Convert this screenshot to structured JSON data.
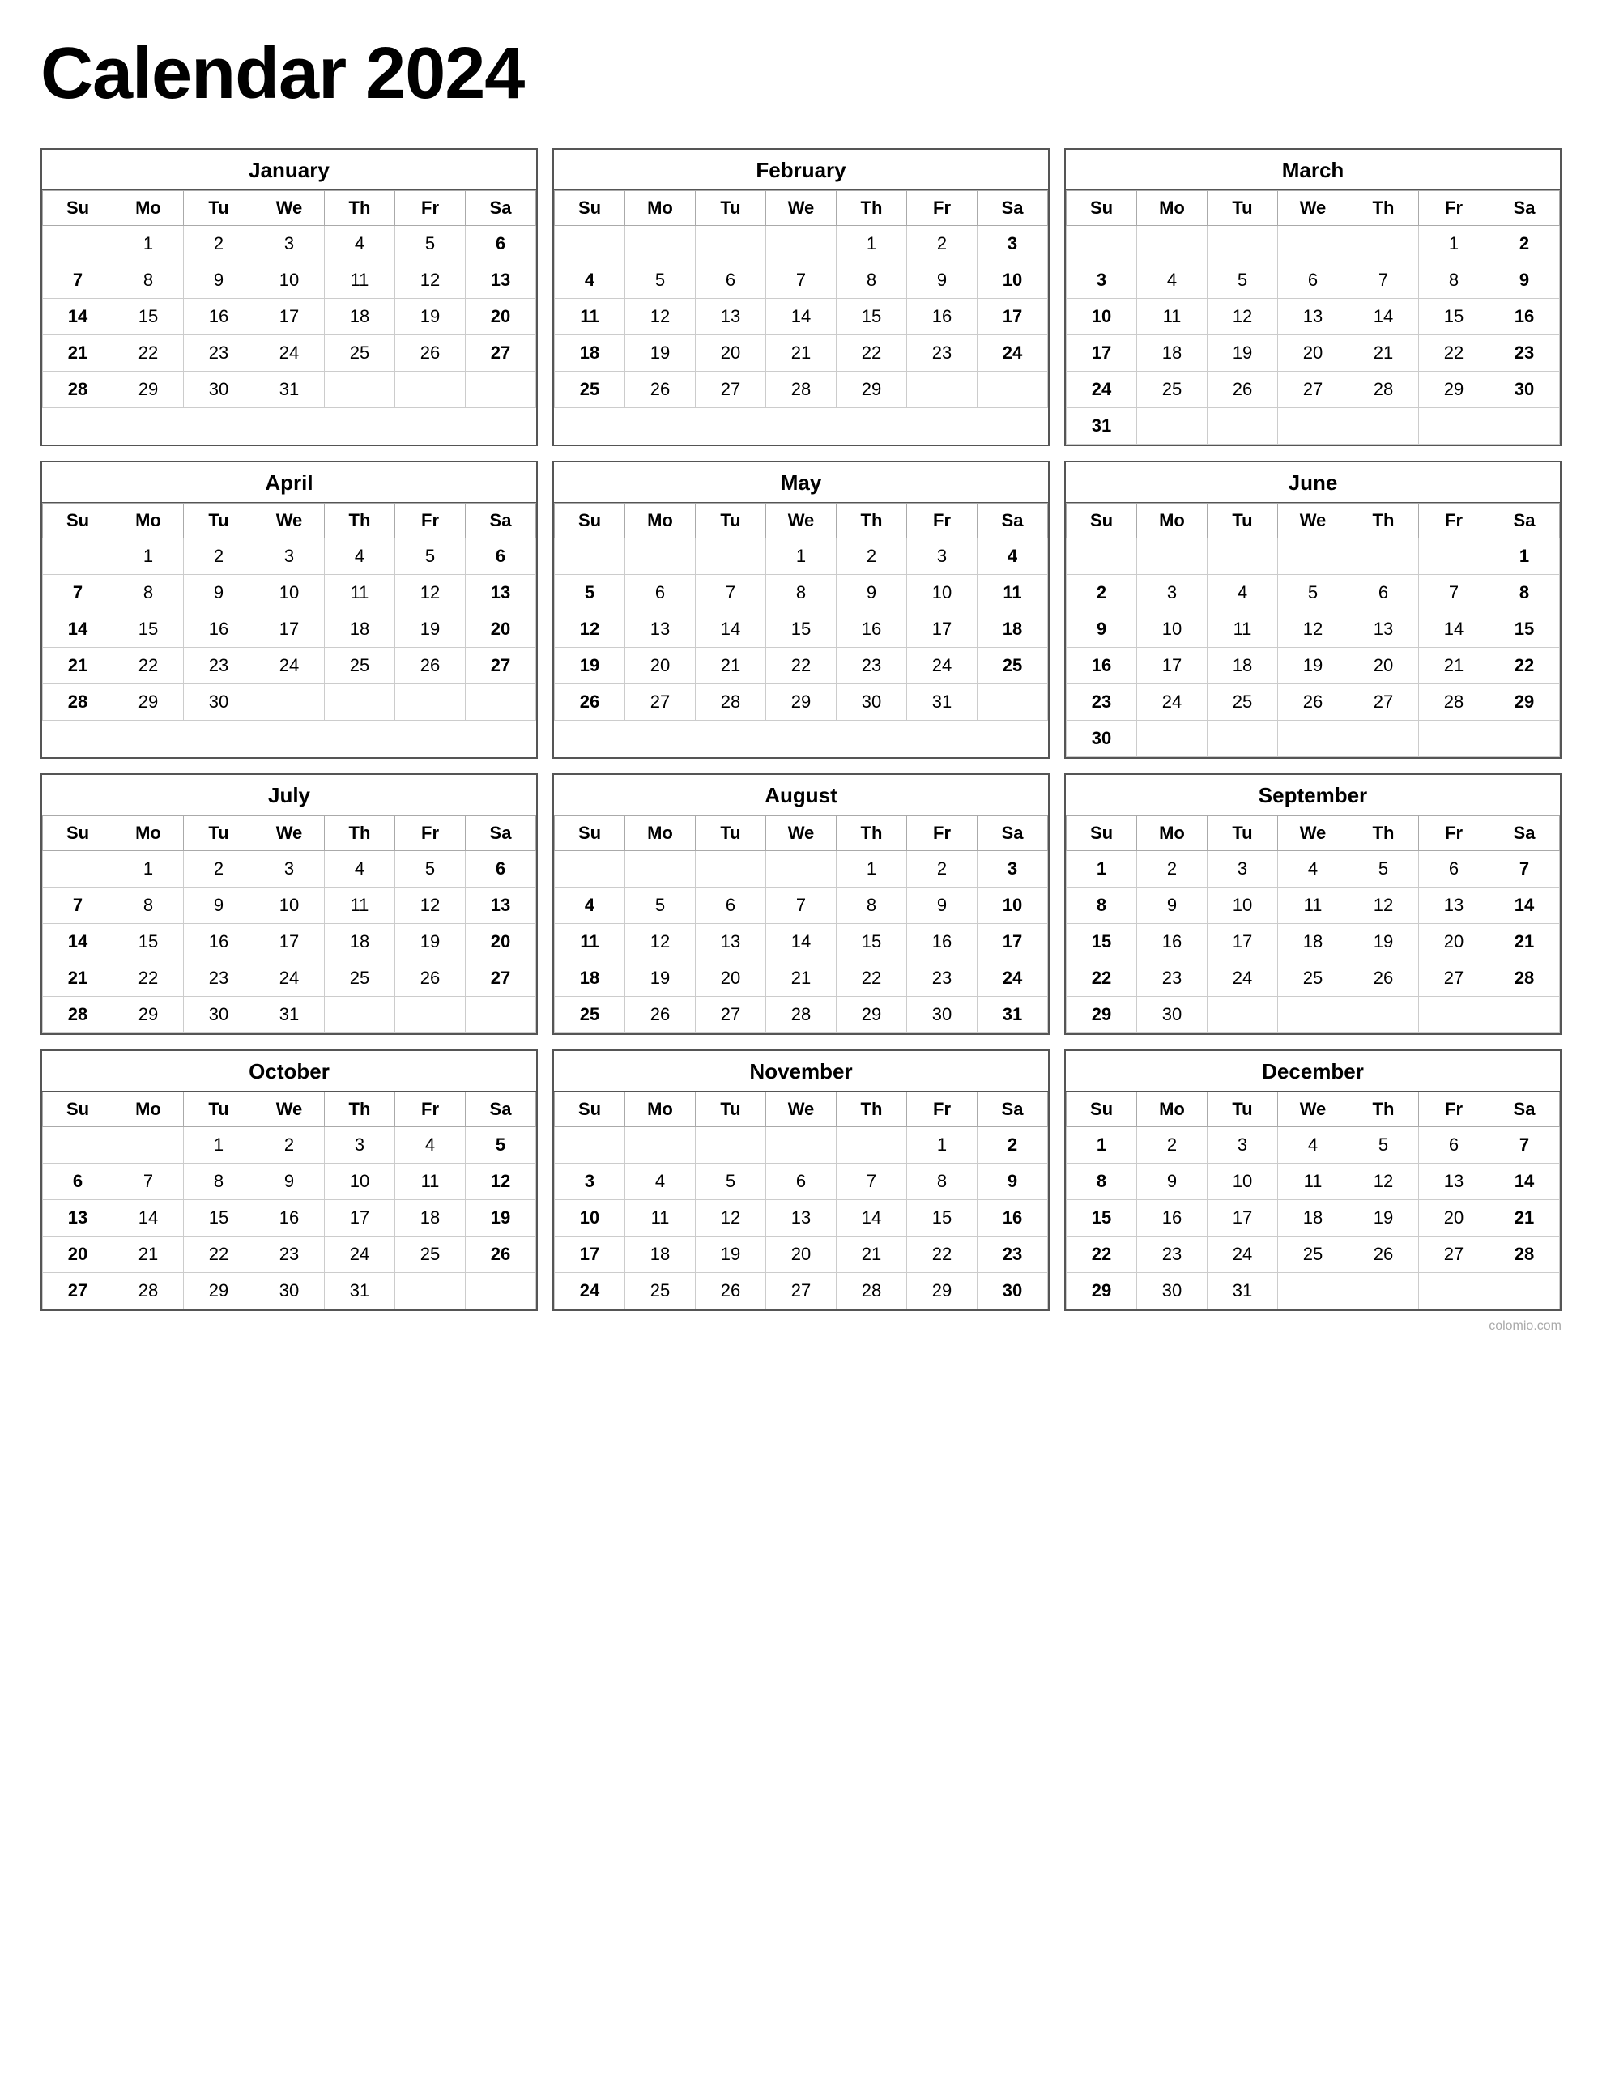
{
  "title": "Calendar 2024",
  "months": [
    {
      "name": "January",
      "weeks": [
        [
          "",
          "1",
          "2",
          "3",
          "4",
          "5",
          "6"
        ],
        [
          "7",
          "8",
          "9",
          "10",
          "11",
          "12",
          "13"
        ],
        [
          "14",
          "15",
          "16",
          "17",
          "18",
          "19",
          "20"
        ],
        [
          "21",
          "22",
          "23",
          "24",
          "25",
          "26",
          "27"
        ],
        [
          "28",
          "29",
          "30",
          "31",
          "",
          "",
          ""
        ]
      ],
      "bold_sun": [
        "7",
        "14",
        "21",
        "28"
      ],
      "bold_sat": [
        "6",
        "13",
        "20",
        "27"
      ]
    },
    {
      "name": "February",
      "weeks": [
        [
          "",
          "",
          "",
          "",
          "1",
          "2",
          "3"
        ],
        [
          "4",
          "5",
          "6",
          "7",
          "8",
          "9",
          "10"
        ],
        [
          "11",
          "12",
          "13",
          "14",
          "15",
          "16",
          "17"
        ],
        [
          "18",
          "19",
          "20",
          "21",
          "22",
          "23",
          "24"
        ],
        [
          "25",
          "26",
          "27",
          "28",
          "29",
          "",
          ""
        ]
      ],
      "bold_sun": [
        "4",
        "11",
        "18",
        "25"
      ],
      "bold_sat": [
        "3",
        "10",
        "17",
        "24"
      ]
    },
    {
      "name": "March",
      "weeks": [
        [
          "",
          "",
          "",
          "",
          "",
          "1",
          "2"
        ],
        [
          "3",
          "4",
          "5",
          "6",
          "7",
          "8",
          "9"
        ],
        [
          "10",
          "11",
          "12",
          "13",
          "14",
          "15",
          "16"
        ],
        [
          "17",
          "18",
          "19",
          "20",
          "21",
          "22",
          "23"
        ],
        [
          "24",
          "25",
          "26",
          "27",
          "28",
          "29",
          "30"
        ],
        [
          "31",
          "",
          "",
          "",
          "",
          "",
          ""
        ]
      ],
      "bold_sun": [
        "3",
        "10",
        "17",
        "24",
        "31"
      ],
      "bold_sat": [
        "2",
        "9",
        "16",
        "23",
        "30"
      ]
    },
    {
      "name": "April",
      "weeks": [
        [
          "",
          "1",
          "2",
          "3",
          "4",
          "5",
          "6"
        ],
        [
          "7",
          "8",
          "9",
          "10",
          "11",
          "12",
          "13"
        ],
        [
          "14",
          "15",
          "16",
          "17",
          "18",
          "19",
          "20"
        ],
        [
          "21",
          "22",
          "23",
          "24",
          "25",
          "26",
          "27"
        ],
        [
          "28",
          "29",
          "30",
          "",
          "",
          "",
          ""
        ]
      ],
      "bold_sun": [
        "7",
        "14",
        "21",
        "28"
      ],
      "bold_sat": [
        "6",
        "13",
        "20",
        "27"
      ]
    },
    {
      "name": "May",
      "weeks": [
        [
          "",
          "",
          "",
          "1",
          "2",
          "3",
          "4"
        ],
        [
          "5",
          "6",
          "7",
          "8",
          "9",
          "10",
          "11"
        ],
        [
          "12",
          "13",
          "14",
          "15",
          "16",
          "17",
          "18"
        ],
        [
          "19",
          "20",
          "21",
          "22",
          "23",
          "24",
          "25"
        ],
        [
          "26",
          "27",
          "28",
          "29",
          "30",
          "31",
          ""
        ]
      ],
      "bold_sun": [
        "5",
        "12",
        "19",
        "26"
      ],
      "bold_sat": [
        "4",
        "11",
        "18",
        "25"
      ]
    },
    {
      "name": "June",
      "weeks": [
        [
          "",
          "",
          "",
          "",
          "",
          "",
          "1"
        ],
        [
          "2",
          "3",
          "4",
          "5",
          "6",
          "7",
          "8"
        ],
        [
          "9",
          "10",
          "11",
          "12",
          "13",
          "14",
          "15"
        ],
        [
          "16",
          "17",
          "18",
          "19",
          "20",
          "21",
          "22"
        ],
        [
          "23",
          "24",
          "25",
          "26",
          "27",
          "28",
          "29"
        ],
        [
          "30",
          "",
          "",
          "",
          "",
          "",
          ""
        ]
      ],
      "bold_sun": [
        "2",
        "9",
        "16",
        "23",
        "30"
      ],
      "bold_sat": [
        "1",
        "8",
        "15",
        "22",
        "29"
      ]
    },
    {
      "name": "July",
      "weeks": [
        [
          "",
          "1",
          "2",
          "3",
          "4",
          "5",
          "6"
        ],
        [
          "7",
          "8",
          "9",
          "10",
          "11",
          "12",
          "13"
        ],
        [
          "14",
          "15",
          "16",
          "17",
          "18",
          "19",
          "20"
        ],
        [
          "21",
          "22",
          "23",
          "24",
          "25",
          "26",
          "27"
        ],
        [
          "28",
          "29",
          "30",
          "31",
          "",
          "",
          ""
        ]
      ],
      "bold_sun": [
        "7",
        "14",
        "21",
        "28"
      ],
      "bold_sat": [
        "6",
        "13",
        "20",
        "27"
      ]
    },
    {
      "name": "August",
      "weeks": [
        [
          "",
          "",
          "",
          "",
          "1",
          "2",
          "3"
        ],
        [
          "4",
          "5",
          "6",
          "7",
          "8",
          "9",
          "10"
        ],
        [
          "11",
          "12",
          "13",
          "14",
          "15",
          "16",
          "17"
        ],
        [
          "18",
          "19",
          "20",
          "21",
          "22",
          "23",
          "24"
        ],
        [
          "25",
          "26",
          "27",
          "28",
          "29",
          "30",
          "31"
        ]
      ],
      "bold_sun": [
        "4",
        "11",
        "18",
        "25"
      ],
      "bold_sat": [
        "3",
        "10",
        "17",
        "24",
        "31"
      ]
    },
    {
      "name": "September",
      "weeks": [
        [
          "1",
          "2",
          "3",
          "4",
          "5",
          "6",
          "7"
        ],
        [
          "8",
          "9",
          "10",
          "11",
          "12",
          "13",
          "14"
        ],
        [
          "15",
          "16",
          "17",
          "18",
          "19",
          "20",
          "21"
        ],
        [
          "22",
          "23",
          "24",
          "25",
          "26",
          "27",
          "28"
        ],
        [
          "29",
          "30",
          "",
          "",
          "",
          "",
          ""
        ]
      ],
      "bold_sun": [
        "1",
        "8",
        "15",
        "22",
        "29"
      ],
      "bold_sat": [
        "7",
        "14",
        "21",
        "28"
      ]
    },
    {
      "name": "October",
      "weeks": [
        [
          "",
          "",
          "1",
          "2",
          "3",
          "4",
          "5"
        ],
        [
          "6",
          "7",
          "8",
          "9",
          "10",
          "11",
          "12"
        ],
        [
          "13",
          "14",
          "15",
          "16",
          "17",
          "18",
          "19"
        ],
        [
          "20",
          "21",
          "22",
          "23",
          "24",
          "25",
          "26"
        ],
        [
          "27",
          "28",
          "29",
          "30",
          "31",
          "",
          ""
        ]
      ],
      "bold_sun": [
        "6",
        "13",
        "20",
        "27"
      ],
      "bold_sat": [
        "5",
        "12",
        "19",
        "26"
      ]
    },
    {
      "name": "November",
      "weeks": [
        [
          "",
          "",
          "",
          "",
          "",
          "1",
          "2"
        ],
        [
          "3",
          "4",
          "5",
          "6",
          "7",
          "8",
          "9"
        ],
        [
          "10",
          "11",
          "12",
          "13",
          "14",
          "15",
          "16"
        ],
        [
          "17",
          "18",
          "19",
          "20",
          "21",
          "22",
          "23"
        ],
        [
          "24",
          "25",
          "26",
          "27",
          "28",
          "29",
          "30"
        ]
      ],
      "bold_sun": [
        "3",
        "10",
        "17",
        "24"
      ],
      "bold_sat": [
        "2",
        "9",
        "16",
        "23",
        "30"
      ]
    },
    {
      "name": "December",
      "weeks": [
        [
          "1",
          "2",
          "3",
          "4",
          "5",
          "6",
          "7"
        ],
        [
          "8",
          "9",
          "10",
          "11",
          "12",
          "13",
          "14"
        ],
        [
          "15",
          "16",
          "17",
          "18",
          "19",
          "20",
          "21"
        ],
        [
          "22",
          "23",
          "24",
          "25",
          "26",
          "27",
          "28"
        ],
        [
          "29",
          "30",
          "31",
          "",
          "",
          "",
          ""
        ]
      ],
      "bold_sun": [
        "1",
        "8",
        "15",
        "22",
        "29"
      ],
      "bold_sat": [
        "7",
        "14",
        "21",
        "28"
      ]
    }
  ],
  "days": [
    "Su",
    "Mo",
    "Tu",
    "We",
    "Th",
    "Fr",
    "Sa"
  ],
  "watermark": "colomio.com"
}
